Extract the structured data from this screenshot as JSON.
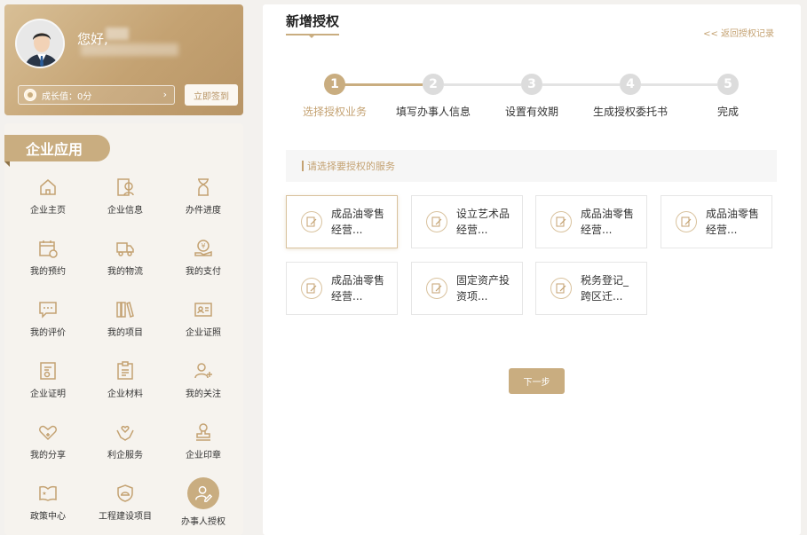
{
  "colors": {
    "accent": "#c9ad80",
    "accent_dark": "#b89566",
    "inactive": "#dcdcdc",
    "step_line_inactive": "#e3e3e3"
  },
  "user": {
    "greeting": "您好,",
    "growth_label": "成长值：0分",
    "signin_label": "立即签到"
  },
  "apps": {
    "title": "企业应用",
    "items": [
      {
        "label": "企业主页",
        "icon": "home-icon"
      },
      {
        "label": "企业信息",
        "icon": "company-info-icon"
      },
      {
        "label": "办件进度",
        "icon": "hourglass-icon"
      },
      {
        "label": "我的预约",
        "icon": "calendar-clock-icon"
      },
      {
        "label": "我的物流",
        "icon": "truck-icon"
      },
      {
        "label": "我的支付",
        "icon": "payment-icon"
      },
      {
        "label": "我的评价",
        "icon": "comment-icon"
      },
      {
        "label": "我的项目",
        "icon": "books-icon"
      },
      {
        "label": "企业证照",
        "icon": "license-card-icon"
      },
      {
        "label": "企业证明",
        "icon": "certificate-icon"
      },
      {
        "label": "企业材料",
        "icon": "clipboard-icon"
      },
      {
        "label": "我的关注",
        "icon": "follow-user-icon"
      },
      {
        "label": "我的分享",
        "icon": "share-heart-icon"
      },
      {
        "label": "利企服务",
        "icon": "hands-heart-icon"
      },
      {
        "label": "企业印章",
        "icon": "seal-icon"
      },
      {
        "label": "政策中心",
        "icon": "policy-book-icon"
      },
      {
        "label": "工程建设项目",
        "icon": "helmet-icon"
      },
      {
        "label": "办事人授权",
        "icon": "authorize-user-icon"
      }
    ]
  },
  "main": {
    "title": "新增授权",
    "back_link": "<< 返回授权记录",
    "current_step": 1,
    "steps": [
      {
        "num": "1",
        "label": "选择授权业务"
      },
      {
        "num": "2",
        "label": "填写办事人信息"
      },
      {
        "num": "3",
        "label": "设置有效期"
      },
      {
        "num": "4",
        "label": "生成授权委托书"
      },
      {
        "num": "5",
        "label": "完成"
      }
    ],
    "services_header": "请选择要授权的服务",
    "services": [
      {
        "name": "成品油零售经营..."
      },
      {
        "name": "设立艺术品经营..."
      },
      {
        "name": "成品油零售经营..."
      },
      {
        "name": "成品油零售经营..."
      },
      {
        "name": "成品油零售经营..."
      },
      {
        "name": "固定资产投资项..."
      },
      {
        "name": "税务登记_跨区迁..."
      }
    ],
    "next_button": "下一步"
  }
}
